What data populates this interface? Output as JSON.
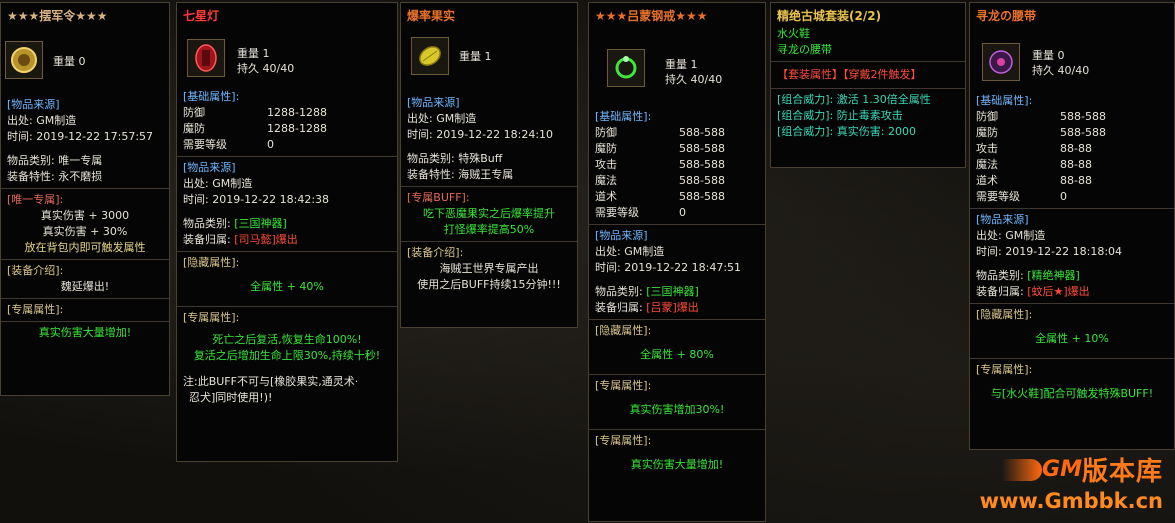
{
  "cards": {
    "c1": {
      "title": "★★★摆军令★★★",
      "weight": "重量 0",
      "src_hdr": "[物品来源]",
      "src_from": "出处: GM制造",
      "src_time": "时间: 2019-12-22 17:57:57",
      "cat": "物品类别: 唯一专属",
      "feat": "装备特性: 永不磨损",
      "uniq_hdr": "[唯一专属]:",
      "uniq1": "真实伤害 + 3000",
      "uniq2": "真实伤害 + 30%",
      "uniq3": "放在背包内即可触发属性",
      "intro_hdr": "[装备介绍]:",
      "intro": "魏延爆出!",
      "excl_hdr": "[专属属性]:",
      "excl": "真实伤害大量增加!"
    },
    "c2": {
      "title": "七星灯",
      "weight": "重量  1",
      "dur": "持久  40/40",
      "base_hdr": "[基础属性]:",
      "def_k": "防御",
      "def_v": "1288-1288",
      "mdef_k": "魔防",
      "mdef_v": "1288-1288",
      "lvl_k": "需要等级",
      "lvl_v": "0",
      "src_hdr": "[物品来源]",
      "src_from": "出处: GM制造",
      "src_time": "时间: 2019-12-22 18:42:38",
      "cat_k": "物品类别: ",
      "cat_v": "[三国神器]",
      "own_k": "装备归属: ",
      "own_v": "[司马懿]爆出",
      "hid_hdr": "[隐藏属性]:",
      "hid": "全属性 + 40%",
      "excl_hdr": "[专属属性]:",
      "excl1": "死亡之后复活,恢复生命100%!",
      "excl2": "复活之后增加生命上限30%,持续十秒!",
      "note1": "注:此BUFF不可与[橡胶果实,通灵术·",
      "note2": "忍犬]同时使用!)!"
    },
    "c3": {
      "title": "爆率果实",
      "weight": "重量  1",
      "src_hdr": "[物品来源]",
      "src_from": "出处: GM制造",
      "src_time": "时间: 2019-12-22 18:24:10",
      "cat": "物品类别: 特殊Buff",
      "feat": "装备特性: 海贼王专属",
      "buff_hdr": "[专属BUFF]:",
      "buff1": "吃下恶魔果实之后爆率提升",
      "buff2": "打怪爆率提高50%",
      "intro_hdr": "[装备介绍]:",
      "intro1": "海贼王世界专属产出",
      "intro2": "使用之后BUFF持续15分钟!!!"
    },
    "c4": {
      "title": "★★★吕蒙钢戒★★★",
      "weight": "重量  1",
      "dur": "持久  40/40",
      "base_hdr": "[基础属性]:",
      "stats": [
        {
          "k": "防御",
          "v": "588-588"
        },
        {
          "k": "魔防",
          "v": "588-588"
        },
        {
          "k": "攻击",
          "v": "588-588"
        },
        {
          "k": "魔法",
          "v": "588-588"
        },
        {
          "k": "道术",
          "v": "588-588"
        },
        {
          "k": "需要等级",
          "v": "0"
        }
      ],
      "src_hdr": "[物品来源]",
      "src_from": "出处: GM制造",
      "src_time": "时间: 2019-12-22 18:47:51",
      "cat_k": "物品类别: ",
      "cat_v": "[三国神器]",
      "own_k": "装备归属: ",
      "own_v": "[吕蒙]爆出",
      "hid_hdr": "[隐藏属性]:",
      "hid": "全属性 + 80%",
      "excl_hdr": "[专属属性]:",
      "excl": "真实伤害增加30%!",
      "excl2_hdr": "[专属属性]:",
      "excl2": "真实伤害大量增加!"
    },
    "c5": {
      "title": "精绝古城套装(2/2)",
      "item1": "水火鞋",
      "item2": "寻龙の腰带",
      "set_hdr": "【套装属性】【穿戴2件触发】",
      "combo1": "[组合威力]: 激活 1.30倍全属性",
      "combo2": "[组合威力]: 防止毒素攻击",
      "combo3": "[组合威力]: 真实伤害: 2000"
    },
    "c6": {
      "title": "寻龙の腰带",
      "weight": "重量  0",
      "dur": "持久  40/40",
      "base_hdr": "[基础属性]:",
      "stats": [
        {
          "k": "防御",
          "v": "588-588"
        },
        {
          "k": "魔防",
          "v": "588-588"
        },
        {
          "k": "攻击",
          "v": "88-88"
        },
        {
          "k": "魔法",
          "v": "88-88"
        },
        {
          "k": "道术",
          "v": "88-88"
        },
        {
          "k": "需要等级",
          "v": "0"
        }
      ],
      "src_hdr": "[物品来源]",
      "src_from": "出处: GM制造",
      "src_time": "时间: 2019-12-22 18:18:04",
      "cat_k": "物品类别: ",
      "cat_v": "[精绝神器]",
      "own_k": "装备归属: ",
      "own_v": "[蚊后★]爆出",
      "hid_hdr": "[隐藏属性]:",
      "hid": "全属性 + 10%",
      "excl_hdr": "[专属属性]:",
      "excl": "与[水火鞋]配合可触发特殊BUFF!"
    }
  },
  "logo": {
    "brand": "版本库",
    "gm": "GM",
    "url": "www.Gmbbk.cn"
  },
  "colors": {
    "orange_title": "#e8702a",
    "gold_title": "#e8c24a",
    "blue_header": "#6fb6ff",
    "green_value": "#39e639",
    "red_value": "#ff4b3a"
  }
}
